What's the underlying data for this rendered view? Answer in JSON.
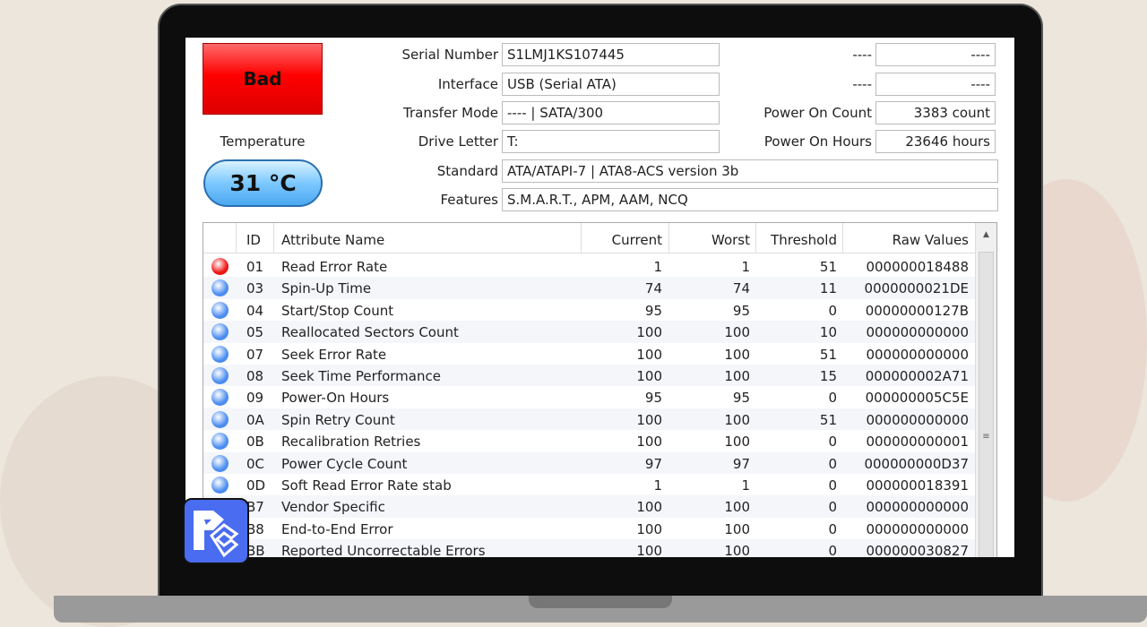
{
  "health": "Bad",
  "temperature_label": "Temperature",
  "temperature": "31 °C",
  "info": [
    {
      "label": "Serial Number",
      "value": "S1LMJ1KS107445"
    },
    {
      "label": "Interface",
      "value": "USB (Serial ATA)"
    },
    {
      "label": "Transfer Mode",
      "value": "---- | SATA/300"
    },
    {
      "label": "Drive Letter",
      "value": "T:"
    },
    {
      "label": "Standard",
      "value": "ATA/ATAPI-7 | ATA8-ACS version 3b"
    },
    {
      "label": "Features",
      "value": "S.M.A.R.T., APM, AAM, NCQ"
    }
  ],
  "right_info": [
    {
      "label": "----",
      "value": "----"
    },
    {
      "label": "----",
      "value": "----"
    },
    {
      "label": "Power On Count",
      "value": "3383 count"
    },
    {
      "label": "Power On Hours",
      "value": "23646 hours"
    }
  ],
  "table": {
    "headers": [
      "ID",
      "Attribute Name",
      "Current",
      "Worst",
      "Threshold",
      "Raw Values"
    ],
    "rows": [
      {
        "status": "bad",
        "id": "01",
        "name": "Read Error Rate",
        "current": "1",
        "worst": "1",
        "threshold": "51",
        "raw": "000000018488"
      },
      {
        "status": "good",
        "id": "03",
        "name": "Spin-Up Time",
        "current": "74",
        "worst": "74",
        "threshold": "11",
        "raw": "0000000021DE"
      },
      {
        "status": "good",
        "id": "04",
        "name": "Start/Stop Count",
        "current": "95",
        "worst": "95",
        "threshold": "0",
        "raw": "00000000127B"
      },
      {
        "status": "good",
        "id": "05",
        "name": "Reallocated Sectors Count",
        "current": "100",
        "worst": "100",
        "threshold": "10",
        "raw": "000000000000"
      },
      {
        "status": "good",
        "id": "07",
        "name": "Seek Error Rate",
        "current": "100",
        "worst": "100",
        "threshold": "51",
        "raw": "000000000000"
      },
      {
        "status": "good",
        "id": "08",
        "name": "Seek Time Performance",
        "current": "100",
        "worst": "100",
        "threshold": "15",
        "raw": "000000002A71"
      },
      {
        "status": "good",
        "id": "09",
        "name": "Power-On Hours",
        "current": "95",
        "worst": "95",
        "threshold": "0",
        "raw": "000000005C5E"
      },
      {
        "status": "good",
        "id": "0A",
        "name": "Spin Retry Count",
        "current": "100",
        "worst": "100",
        "threshold": "51",
        "raw": "000000000000"
      },
      {
        "status": "good",
        "id": "0B",
        "name": "Recalibration Retries",
        "current": "100",
        "worst": "100",
        "threshold": "0",
        "raw": "000000000001"
      },
      {
        "status": "good",
        "id": "0C",
        "name": "Power Cycle Count",
        "current": "97",
        "worst": "97",
        "threshold": "0",
        "raw": "000000000D37"
      },
      {
        "status": "good",
        "id": "0D",
        "name": "Soft Read Error Rate stab",
        "current": "1",
        "worst": "1",
        "threshold": "0",
        "raw": "000000018391"
      },
      {
        "status": "good",
        "id": "B7",
        "name": "Vendor Specific",
        "current": "100",
        "worst": "100",
        "threshold": "0",
        "raw": "000000000000"
      },
      {
        "status": "good",
        "id": "B8",
        "name": "End-to-End Error",
        "current": "100",
        "worst": "100",
        "threshold": "0",
        "raw": "000000000000"
      },
      {
        "status": "good",
        "id": "BB",
        "name": "Reported Uncorrectable Errors",
        "current": "100",
        "worst": "100",
        "threshold": "0",
        "raw": "000000030827"
      }
    ]
  },
  "colors": {
    "bad": "#ee1111",
    "good": "#4a8cf0"
  }
}
